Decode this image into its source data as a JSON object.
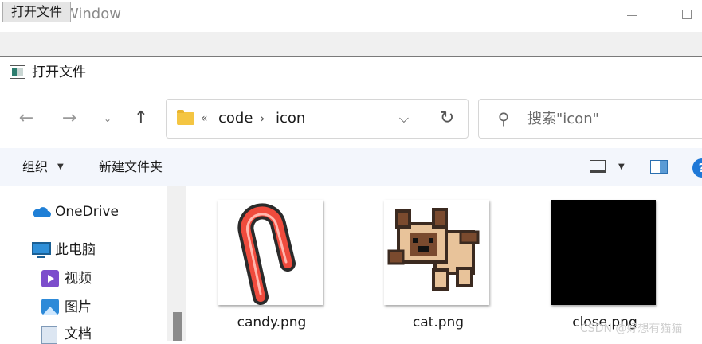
{
  "main_window": {
    "title": "MainWindow",
    "open_file_button": "打开文件"
  },
  "dialog": {
    "title": "打开文件",
    "breadcrumb": {
      "overflow": "«",
      "items": [
        "code",
        "icon"
      ],
      "separator": "›"
    },
    "search": {
      "placeholder": "搜索\"icon\""
    },
    "command_bar": {
      "organize": "组织",
      "new_folder": "新建文件夹"
    },
    "nav_pane": {
      "items": [
        {
          "label": "OneDrive",
          "icon": "onedrive-icon"
        },
        {
          "label": "此电脑",
          "icon": "computer-icon"
        },
        {
          "label": "视频",
          "icon": "videos-icon"
        },
        {
          "label": "图片",
          "icon": "pictures-icon"
        },
        {
          "label": "文档",
          "icon": "documents-icon"
        }
      ]
    },
    "files": [
      {
        "name": "candy.png",
        "thumbnail": "candy-cane-icon"
      },
      {
        "name": "cat.png",
        "thumbnail": "pixel-cat-icon"
      },
      {
        "name": "close.png",
        "thumbnail": "black-square"
      }
    ]
  },
  "watermark": "CSDN @好想有猫猫",
  "colors": {
    "accent": "#1e78d7",
    "command_bar_bg": "#f3f6fc",
    "folder": "#f4c542"
  }
}
